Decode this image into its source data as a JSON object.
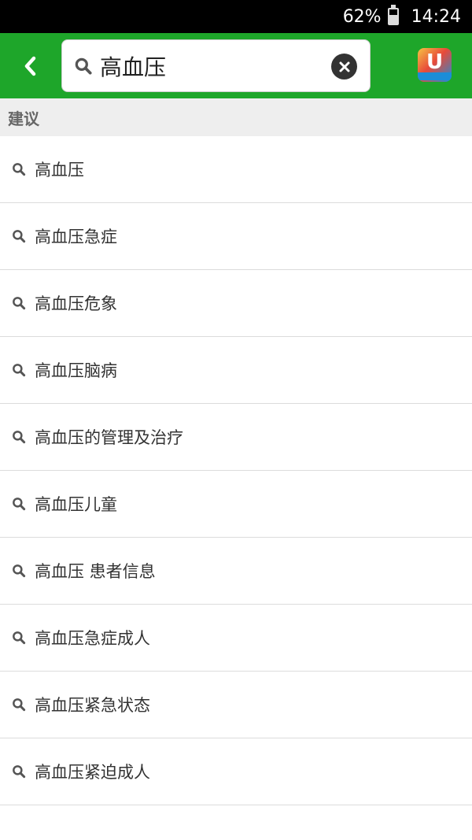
{
  "status_bar": {
    "battery": "62%",
    "time": "14:24"
  },
  "search": {
    "value": "高血压"
  },
  "app_logo": {
    "letter": "U"
  },
  "section": {
    "title": "建议"
  },
  "suggestions": [
    "高血压",
    "高血压急症",
    "高血压危象",
    "高血压脑病",
    "高血压的管理及治疗",
    "高血压儿童",
    "高血压 患者信息",
    "高血压急症成人",
    "高血压紧急状态",
    "高血压紧迫成人"
  ],
  "colors": {
    "top_bar": "#1ea62a",
    "status_bar": "#000000",
    "section_bg": "#eeeeee"
  }
}
